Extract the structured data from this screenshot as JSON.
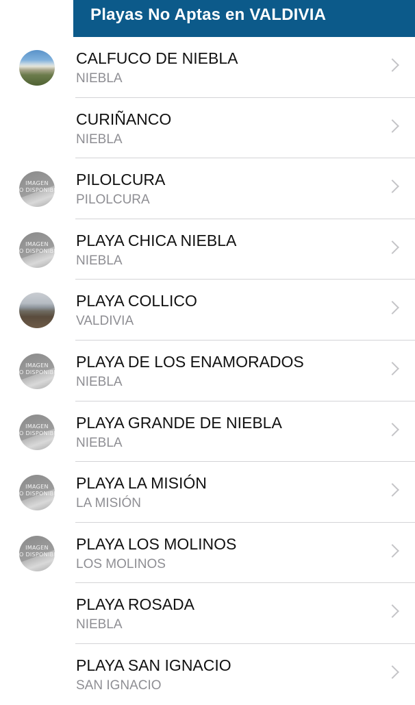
{
  "header": {
    "title": "Playas No Aptas en VALDIVIA"
  },
  "placeholder_image_text": {
    "line1": "IMAGEN",
    "line2": "O DISPONIBL"
  },
  "colors": {
    "header_background": "#0c5a8a",
    "title_text": "#111111",
    "subtitle_text": "#8e8e93",
    "chevron": "#c4c4c7"
  },
  "beaches": [
    {
      "name": "CALFUCO DE NIEBLA",
      "location": "NIEBLA",
      "thumbnail": "beach-photo"
    },
    {
      "name": "CURIÑANCO",
      "location": "NIEBLA",
      "thumbnail": "none"
    },
    {
      "name": "PILOLCURA",
      "location": "PILOLCURA",
      "thumbnail": "image-not-available"
    },
    {
      "name": "PLAYA CHICA NIEBLA",
      "location": "NIEBLA",
      "thumbnail": "image-not-available"
    },
    {
      "name": "PLAYA COLLICO",
      "location": "VALDIVIA",
      "thumbnail": "beach-photo"
    },
    {
      "name": "PLAYA DE LOS ENAMORADOS",
      "location": "NIEBLA",
      "thumbnail": "image-not-available"
    },
    {
      "name": "PLAYA GRANDE DE NIEBLA",
      "location": "NIEBLA",
      "thumbnail": "image-not-available"
    },
    {
      "name": "PLAYA LA MISIÓN",
      "location": "LA MISIÓN",
      "thumbnail": "image-not-available"
    },
    {
      "name": "PLAYA LOS MOLINOS",
      "location": "LOS MOLINOS",
      "thumbnail": "image-not-available"
    },
    {
      "name": "PLAYA ROSADA",
      "location": "NIEBLA",
      "thumbnail": "none"
    },
    {
      "name": "PLAYA SAN IGNACIO",
      "location": "SAN IGNACIO",
      "thumbnail": "none"
    }
  ]
}
